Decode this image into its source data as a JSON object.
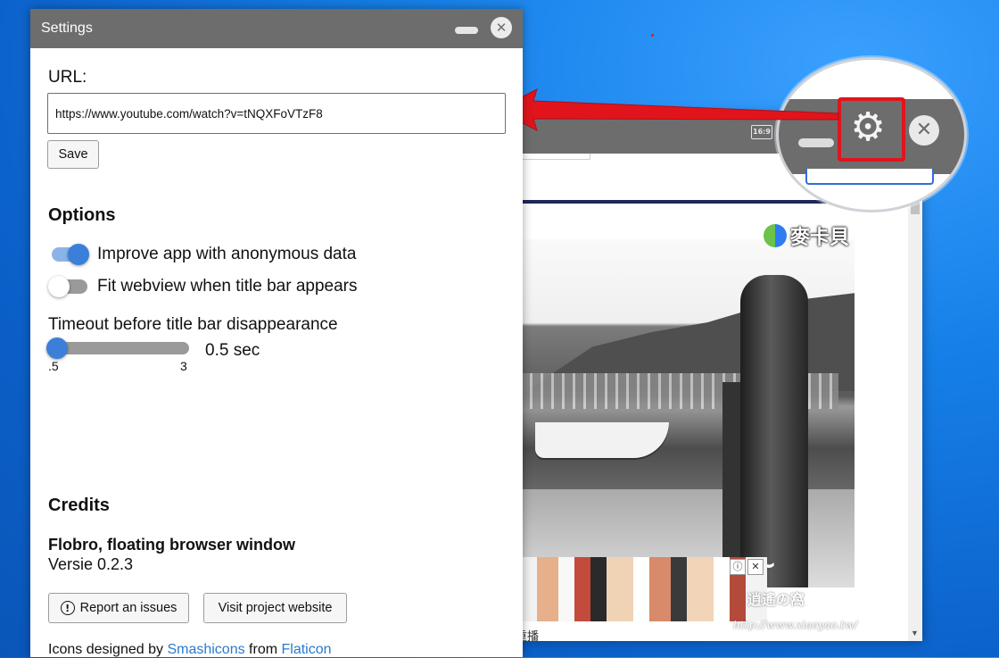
{
  "settings": {
    "title": "Settings",
    "url_label": "URL:",
    "url_value": "https://www.youtube.com/watch?v=tNQXFoVTzF8",
    "save_label": "Save",
    "options_heading": "Options",
    "options": [
      {
        "label": "Improve app with anonymous data",
        "enabled": true
      },
      {
        "label": "Fit webview when title bar appears",
        "enabled": false
      }
    ],
    "timeout": {
      "label": "Timeout before title bar disappearance",
      "min_label": ".5",
      "max_label": "3",
      "min": 0.5,
      "max": 3,
      "value": 0.5,
      "value_text": "0.5 sec"
    },
    "credits_heading": "Credits",
    "app_name": "Flobro, floating browser window",
    "app_version": "Versie 0.2.3",
    "report_label": "Report an issues",
    "visit_label": "Visit project website",
    "icons_prefix": "Icons designed by",
    "icons_author": "Smashicons",
    "icons_mid": "from",
    "icons_source": "Flaticon"
  },
  "background_window": {
    "ratio_label": "16:9",
    "brand_text": "麥卡貝",
    "footer_text": "重播",
    "watermark": "逍遙の窩",
    "watermark_url": "http://www.xiaoyao.tw/"
  },
  "magnifier": {
    "gear_icon": "gear-icon",
    "close_icon": "close-icon"
  },
  "colors": {
    "titlebar": "#6d6d6d",
    "accent": "#3b7fd9",
    "highlight": "#e1141c",
    "link": "#2a7ad0"
  }
}
